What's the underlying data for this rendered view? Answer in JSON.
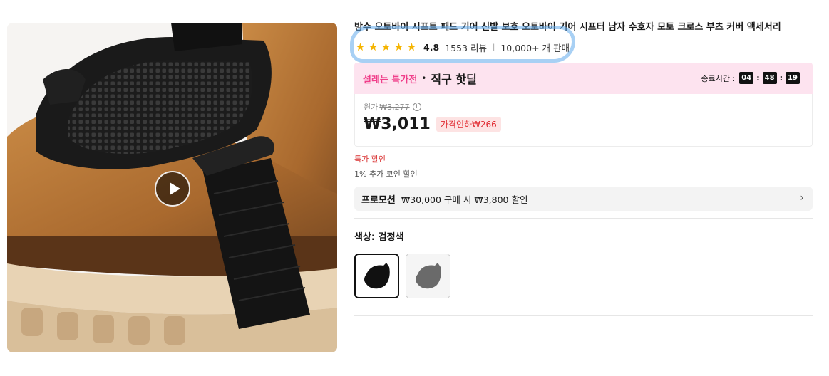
{
  "product": {
    "title": "방수 오토바이 시프트 패드 기어 신발 보호 오토바이 기어 시프터 남자 수호자 모토 크로스 부츠 커버 액세서리",
    "image_icon": "boot-shifter-photo",
    "play_icon": "play-icon"
  },
  "rating": {
    "stars": [
      "★",
      "★",
      "★",
      "★",
      "★"
    ],
    "value": "4.8",
    "reviews": "1553 리뷰",
    "separator": "|",
    "sold": "10,000+ 개 판매"
  },
  "deal": {
    "tag": "설레는 특가전",
    "dot": "•",
    "title": "직구 핫딜",
    "timer_label": "종료시간 :",
    "hours": "04",
    "minutes": "48",
    "seconds": "19",
    "colon": ":"
  },
  "price": {
    "original_label": "원가",
    "original": "₩3,277",
    "info": "i",
    "current": "₩3,011",
    "discount": "가격인하₩266"
  },
  "offers": {
    "special": "특가 할인",
    "coin": "1% 추가 코인 할인"
  },
  "promotion": {
    "label": "프로모션",
    "text": "₩30,000 구매 시 ₩3,800 할인",
    "chevron": "›"
  },
  "color": {
    "label": "색상: 검정색",
    "options": [
      "black-pad-swatch",
      "gray-pad-swatch"
    ]
  },
  "colors": {
    "accent_pink": "#f03e8a",
    "banner_bg": "#fde3ef",
    "discount_red": "#e0282e",
    "star": "#f5b400",
    "highlight": "#60aaeb"
  }
}
